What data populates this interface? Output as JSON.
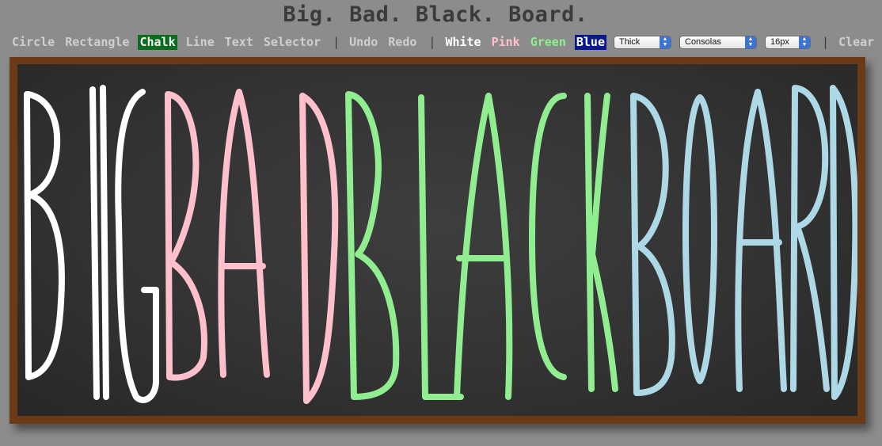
{
  "title": "Big. Bad. Black. Board.",
  "toolbar": {
    "tools": [
      "Circle",
      "Rectangle",
      "Chalk",
      "Line",
      "Text",
      "Selector"
    ],
    "active_tool": "Chalk",
    "history": [
      "Undo",
      "Redo"
    ],
    "colors": [
      "White",
      "Pink",
      "Green",
      "Blue"
    ],
    "active_color": "Blue",
    "thickness_select": "Thick",
    "font_select": "Consolas",
    "size_select": "16px",
    "clear_label": "Clear"
  },
  "colors": {
    "white": "#ffffff",
    "pink": "#ffc0cb",
    "green": "#90ee90",
    "blue": "#add8e6",
    "board": "#333333",
    "frame": "#6b3a16",
    "active_tool_bg": "#0b6b1f",
    "active_color_bg": "#0a1a8c"
  }
}
